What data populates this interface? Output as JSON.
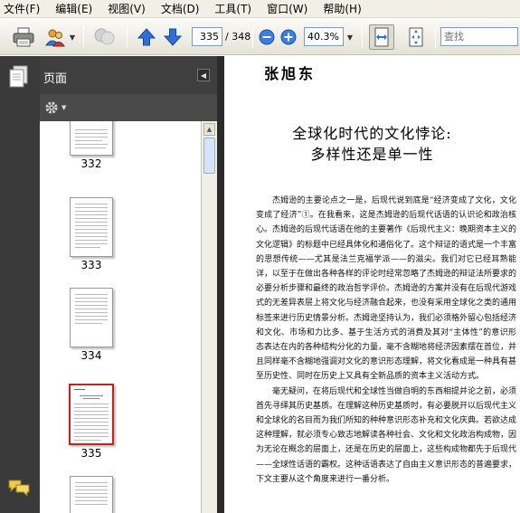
{
  "menu": [
    "文件(F)",
    "编辑(E)",
    "视图(V)",
    "文档(D)",
    "工具(T)",
    "窗口(W)",
    "帮助(H)"
  ],
  "toolbar": {
    "current_page": "335",
    "page_total": "/ 348",
    "zoom": "40.3%",
    "search_placeholder": "查找"
  },
  "panel": {
    "title": "页面",
    "thumbnails": [
      {
        "label": "332",
        "selected": false
      },
      {
        "label": "333",
        "selected": false
      },
      {
        "label": "334",
        "selected": false
      },
      {
        "label": "335",
        "selected": true
      }
    ]
  },
  "document": {
    "author": "张旭东",
    "title_line1": "全球化时代的文化悖论:",
    "title_line2": "多样性还是单一性",
    "paragraph1": "杰姆逊的主要论点之一是，后现代说到底是“经济变成了文化，文化变成了经济”①。在我看来，这是杰姆逊的后现代话语的认识论和政治核心。杰姆逊的后现代话语在他的主要著作《后现代主义：晚期资本主义的文化逻辑》的标题中已经具体化和通俗化了。这个辩证的语式是一个丰富的思想传统——尤其是法兰克福学派——的滋尖。我们对它已经耳熟能详，以至于在做出各种各样的评论时经常忽略了杰姆逊的辩证法所要求的必要分析步骤和最终的政治哲学评价。杰姆逊的方案并没有在后现代游戏式的无差异表层上将文化与经济融合起来，也没有采用全球化之类的通用标签来进行历史情景分析。杰姆逊坚持认为，我们必须格外留心包括经济和文化、市场和力比多、基于生活方式的消费及其对“主体性”的意识形态表达在内的各种结构分化的力量，毫不含糊地将经济因素摆在首位，并且同样毫不含糊地强调对文化的意识形态理解，将文化看成是一种具有甚至历史性、同时在历史上又具有全新品质的资本主义活动方式。",
    "paragraph2": "毫无疑问，在将后现代和全球性当做自明的东西相提并论之前，必须首先寻绎其历史基质。在理解这种历史基质时，有必要脱开以后现代主义和全球化的名目而为我们所知的种种意识形态补充和文化庆典。若欲达成这种理解，就必须专心致志地解读各种社会、文化和文化政治构成物，因为无论在概念的层面上，还是在历史的层面上，这些构成物都先于后现代——全球性话语的霸权。这种话语表达了自由主义意识形态的普遍要求，下文主要从这个角度来进行一番分析。"
  },
  "colors": {
    "menubar_bg": "#f1efe6",
    "panel_bg": "#4a4a4a",
    "selected_thumb_border": "#c8201e",
    "nav_arrow_blue": "#2f6fd6"
  }
}
